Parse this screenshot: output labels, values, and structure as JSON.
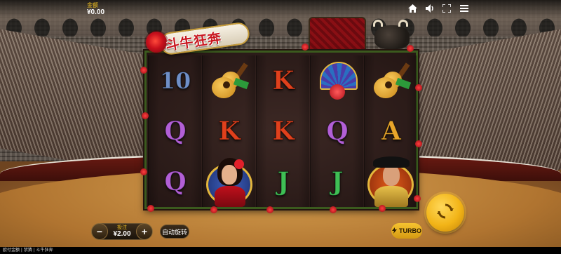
{
  "header": {
    "balance_label": "金额",
    "balance_value": "¥0.00",
    "icons": [
      "home-icon",
      "sound-icon",
      "fullscreen-icon",
      "menu-icon"
    ]
  },
  "logo": {
    "text": "斗牛狂奔"
  },
  "reels": [
    [
      "10",
      "Q",
      "Q"
    ],
    [
      "guitar",
      "K",
      "dancer"
    ],
    [
      "K",
      "K",
      "J"
    ],
    [
      "fan",
      "Q",
      "J"
    ],
    [
      "guitar",
      "A",
      "torero"
    ]
  ],
  "symbol_colors": {
    "10": "#6f8fc8",
    "K": "#e0401c",
    "Q": "#b25fd6",
    "A": "#e8a52a",
    "J": "#3fbf55"
  },
  "controls": {
    "bet_label": "投注",
    "bet_value": "¥2.00",
    "minus": "−",
    "plus": "+",
    "autospin_label": "自动旋转",
    "turbo_label": "TURBO"
  },
  "footer": {
    "text": "欧付金额 | 禁猜 | 斗牛狂奔"
  },
  "colors": {
    "accent": "#f2b417",
    "balance_label": "#f0c020"
  }
}
